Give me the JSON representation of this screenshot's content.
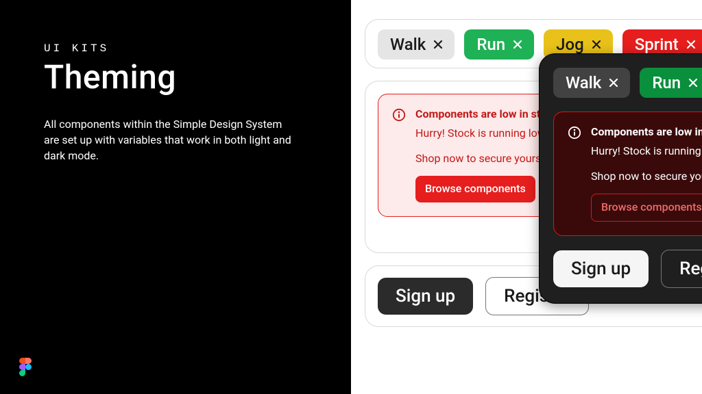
{
  "left": {
    "eyebrow": "UI KITS",
    "title": "Theming",
    "body": "All components within the Simple Design System are set up with variables that work in both light and dark mode."
  },
  "chips": {
    "walk": "Walk",
    "run": "Run",
    "jog": "Jog",
    "sprint": "Sprint"
  },
  "alert": {
    "heading": "Components are low in stock",
    "line1": "Hurry! Stock is running low — get your hands on these popular picks.",
    "line2": "Shop now to secure yours while you still can!",
    "cta": "Browse components"
  },
  "buttons": {
    "primary": "Sign up",
    "secondary": "Register"
  },
  "icons": {
    "close": "close-icon",
    "info": "info-icon",
    "figma": "figma-logo"
  },
  "colors": {
    "green": "#1fb155",
    "yellow": "#e8c21a",
    "red": "#e61e1e",
    "darkBg": "#1f1f1f"
  }
}
